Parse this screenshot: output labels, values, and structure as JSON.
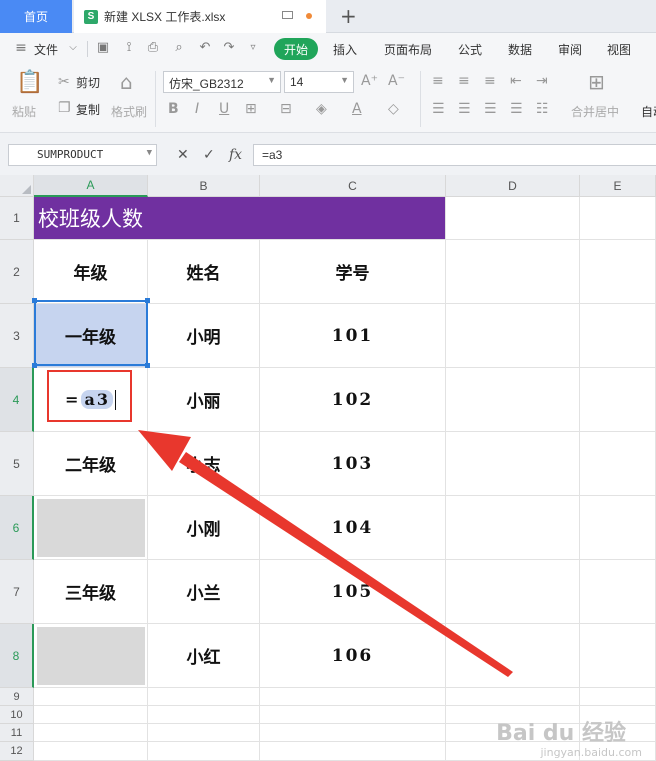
{
  "tabs": {
    "home": "首页",
    "document": "新建 XLSX 工作表.xlsx",
    "xls_badge": "S",
    "new_tab": "+"
  },
  "menu": {
    "file": "文件",
    "items": [
      "开始",
      "插入",
      "页面布局",
      "公式",
      "数据",
      "审阅",
      "视图"
    ],
    "active": "开始",
    "quick_icons": [
      "save-icon",
      "paint-icon",
      "print-icon",
      "preview-icon",
      "undo-icon",
      "redo-icon",
      "more-icon"
    ]
  },
  "ribbon": {
    "paste": "粘贴",
    "cut": "剪切",
    "copy": "复制",
    "format_painter": "格式刷",
    "font_name": "仿宋_GB2312",
    "font_size": "14",
    "merge_center": "合并居中",
    "auto": "自动"
  },
  "formula_bar": {
    "name_box": "SUMPRODUCT",
    "fx": "fx",
    "formula": "=a3"
  },
  "grid": {
    "columns": [
      "A",
      "B",
      "C",
      "D",
      "E"
    ],
    "active_column": "A",
    "rows": [
      "1",
      "2",
      "3",
      "4",
      "5",
      "6",
      "7",
      "8",
      "9",
      "10",
      "11",
      "12"
    ],
    "active_rows": [
      "4",
      "6",
      "8"
    ],
    "title": "校班级人数",
    "headers": {
      "grade": "年级",
      "name": "姓名",
      "id": "学号"
    },
    "data": [
      {
        "grade": "一年级",
        "name": "小明",
        "id": "101"
      },
      {
        "grade": "",
        "name": "小丽",
        "id": "102",
        "editing": "= a3"
      },
      {
        "grade": "二年级",
        "name": "小志",
        "id": "103"
      },
      {
        "grade": "",
        "name": "小刚",
        "id": "104"
      },
      {
        "grade": "三年级",
        "name": "小兰",
        "id": "105"
      },
      {
        "grade": "",
        "name": "小红",
        "id": "106"
      }
    ],
    "edit_eq": "=",
    "edit_ref": "a3",
    "title_color": "#7030a0",
    "highlight_color": "#c6d4ef",
    "fill_gray": "#d9d9d9"
  },
  "watermark": {
    "main": "Bai du 经验",
    "sub": "jingyan.baidu.com"
  },
  "accent": {
    "start_green": "#20a55a",
    "home_blue": "#4a8af4",
    "arrow_red": "#e8372d"
  }
}
